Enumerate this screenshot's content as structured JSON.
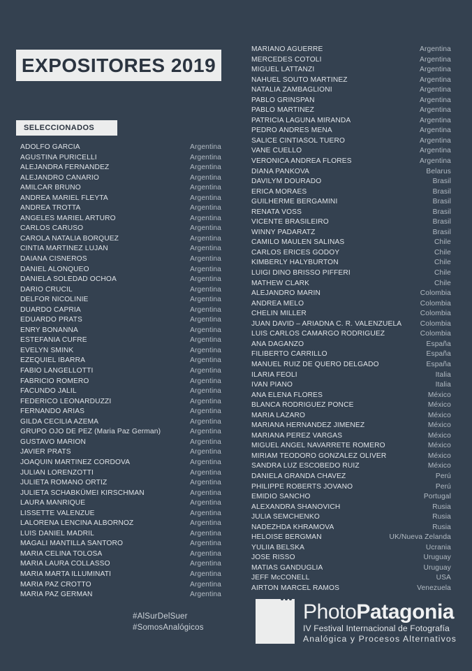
{
  "poster": {
    "background_color": "#344150",
    "panel_color": "#eceded",
    "text_color": "#dfe3e7",
    "country_color": "#b3bcc4"
  },
  "title": "EXPOSITORES 2019",
  "section_label": "SELECCIONADOS",
  "left_column": [
    {
      "name": "ADOLFO GARCIA",
      "country": "Argentina"
    },
    {
      "name": "AGUSTINA PURICELLI",
      "country": "Argentina"
    },
    {
      "name": "ALEJANDRA FERNANDEZ",
      "country": "Argentina"
    },
    {
      "name": "ALEJANDRO CANARIO",
      "country": "Argentina"
    },
    {
      "name": "AMILCAR BRUNO",
      "country": "Argentina"
    },
    {
      "name": "ANDREA MARIEL FLEYTA",
      "country": "Argentina"
    },
    {
      "name": "ANDREA TROTTA",
      "country": "Argentina"
    },
    {
      "name": "ANGELES MARIEL ARTURO",
      "country": "Argentina"
    },
    {
      "name": "CARLOS CARUSO",
      "country": "Argentina"
    },
    {
      "name": "CAROLA NATALIA BORQUEZ",
      "country": "Argentina"
    },
    {
      "name": "CINTIA MARTINEZ LUJAN",
      "country": "Argentina"
    },
    {
      "name": "DAIANA CISNEROS",
      "country": "Argentina"
    },
    {
      "name": "DANIEL ALONQUEO",
      "country": "Argentina"
    },
    {
      "name": "DANIELA SOLEDAD OCHOA",
      "country": "Argentina"
    },
    {
      "name": "DARIO CRUCIL",
      "country": "Argentina"
    },
    {
      "name": "DELFOR NICOLINIE",
      "country": "Argentina"
    },
    {
      "name": "DUARDO CAPRIA",
      "country": "Argentina"
    },
    {
      "name": "EDUARDO PRATS",
      "country": "Argentina"
    },
    {
      "name": "ENRY BONANNA",
      "country": "Argentina"
    },
    {
      "name": "ESTEFANIA CUFRE",
      "country": "Argentina"
    },
    {
      "name": "EVELYN SMINK",
      "country": "Argentina"
    },
    {
      "name": "EZEQUIEL IBARRA",
      "country": "Argentina"
    },
    {
      "name": "FABIO LANGELLOTTI",
      "country": "Argentina"
    },
    {
      "name": "FABRICIO ROMERO",
      "country": "Argentina"
    },
    {
      "name": "FACUNDO JALIL",
      "country": "Argentina"
    },
    {
      "name": "FEDERICO LEONARDUZZI",
      "country": "Argentina"
    },
    {
      "name": "FERNANDO ARIAS",
      "country": "Argentina"
    },
    {
      "name": "GILDA CECILIA AZEMA",
      "country": "Argentina"
    },
    {
      "name": "GRUPO OJO DE PEZ (Maria Paz German)",
      "country": "Argentina"
    },
    {
      "name": "GUSTAVO MARION",
      "country": "Argentina"
    },
    {
      "name": "JAVIER PRATS",
      "country": "Argentina"
    },
    {
      "name": "JOAQUIN MARTINEZ CORDOVA",
      "country": "Argentina"
    },
    {
      "name": "JULIAN LORENZOTTI",
      "country": "Argentina"
    },
    {
      "name": "JULIETA ROMANO ORTIZ",
      "country": "Argentina"
    },
    {
      "name": "JULIETA SCHABKÜMEI KIRSCHMAN",
      "country": "Argentina"
    },
    {
      "name": "LAURA MANRIQUE",
      "country": "Argentina"
    },
    {
      "name": "LISSETTE VALENZUE",
      "country": "Argentina"
    },
    {
      "name": "LALORENA LENCINA ALBORNOZ",
      "country": "Argentina"
    },
    {
      "name": "LUIS DANIEL MADRIL",
      "country": "Argentina"
    },
    {
      "name": "MAGALI MANTILLA SANTORO",
      "country": "Argentina"
    },
    {
      "name": "MARIA CELINA TOLOSA",
      "country": "Argentina"
    },
    {
      "name": "MARIA LAURA COLLASSO",
      "country": "Argentina"
    },
    {
      "name": "MARIA MARTA ILLUMINATI",
      "country": "Argentina"
    },
    {
      "name": "MARIA PAZ CROTTO",
      "country": "Argentina"
    },
    {
      "name": "MARIA PAZ GERMAN",
      "country": "Argentina"
    }
  ],
  "right_column": [
    {
      "name": "MARIANO AGUERRE",
      "country": "Argentina"
    },
    {
      "name": "MERCEDES COTOLI",
      "country": "Argentina"
    },
    {
      "name": "MIGUEL LATTANZI",
      "country": "Argentina"
    },
    {
      "name": "NAHUEL SOUTO MARTINEZ",
      "country": "Argentina"
    },
    {
      "name": "NATALIA ZAMBAGLIONI",
      "country": "Argentina"
    },
    {
      "name": "PABLO GRINSPAN",
      "country": "Argentina"
    },
    {
      "name": "PABLO MARTINEZ",
      "country": "Argentina"
    },
    {
      "name": "PATRICIA LAGUNA MIRANDA",
      "country": "Argentina"
    },
    {
      "name": "PEDRO ANDRES MENA",
      "country": "Argentina"
    },
    {
      "name": "SALICE CINTIASOL TUERO",
      "country": "Argentina"
    },
    {
      "name": "VANE CUELLO",
      "country": "Argentina"
    },
    {
      "name": "VERONICA ANDREA FLORES",
      "country": "Argentina"
    },
    {
      "name": "DIANA PANKOVA",
      "country": "Belarus"
    },
    {
      "name": "DAVILYM DOURADO",
      "country": "Brasil"
    },
    {
      "name": "ERICA MORAES",
      "country": "Brasil"
    },
    {
      "name": "GUILHERME BERGAMINI",
      "country": "Brasil"
    },
    {
      "name": "RENATA VOSS",
      "country": "Brasil"
    },
    {
      "name": "VICENTE BRASILEIRO",
      "country": "Brasil"
    },
    {
      "name": "WINNY PADARATZ",
      "country": "Brasil"
    },
    {
      "name": "CAMILO MAULEN SALINAS",
      "country": "Chile"
    },
    {
      "name": "CARLOS ERICES GODOY",
      "country": "Chile"
    },
    {
      "name": "KIMBERLY HALYBURTON",
      "country": "Chile"
    },
    {
      "name": "LUIGI DINO BRISSO PIFFERI",
      "country": "Chile"
    },
    {
      "name": "MATHEW CLARK",
      "country": "Chile"
    },
    {
      "name": "ALEJANDRO MARIN",
      "country": "Colombia"
    },
    {
      "name": "ANDREA MELO",
      "country": "Colombia"
    },
    {
      "name": "CHELIN MILLER",
      "country": "Colombia"
    },
    {
      "name": "JUAN DAVID – ARIADNA C. R. VALENZUELA",
      "country": "Colombia"
    },
    {
      "name": "LUIS CARLOS CAMARGO RODRIGUEZ",
      "country": "Colombia"
    },
    {
      "name": "ANA DAGANZO",
      "country": "España"
    },
    {
      "name": "FILIBERTO CARRILLO",
      "country": "España"
    },
    {
      "name": "MANUEL RUIZ DE QUERO DELGADO",
      "country": "España"
    },
    {
      "name": "ILARIA FEOLI",
      "country": "Italia"
    },
    {
      "name": "IVAN PIANO",
      "country": "Italia"
    },
    {
      "name": "ANA ELENA FLORES",
      "country": "México"
    },
    {
      "name": "BLANCA RODRIGUEZ PONCE",
      "country": "México"
    },
    {
      "name": "MARIA LAZARO",
      "country": "México"
    },
    {
      "name": "MARIANA HERNANDEZ JIMENEZ",
      "country": "México"
    },
    {
      "name": "MARIANA PEREZ VARGAS",
      "country": "México"
    },
    {
      "name": "MIGUEL ANGEL NAVARRETE ROMERO",
      "country": "México"
    },
    {
      "name": "MIRIAM TEODORO GONZALEZ OLIVER",
      "country": "México"
    },
    {
      "name": "SANDRA LUZ ESCOBEDO RUIZ",
      "country": "México"
    },
    {
      "name": "DANIELA GRANDA CHAVEZ",
      "country": "Perú"
    },
    {
      "name": "PHILIPPE ROBERTS JOVANO",
      "country": "Perú"
    },
    {
      "name": "EMIDIO SANCHO",
      "country": "Portugal"
    },
    {
      "name": "ALEXANDRA SHANOVICH",
      "country": "Rusia"
    },
    {
      "name": "JULIA SEMCHENKO",
      "country": "Rusia"
    },
    {
      "name": "NADEZHDA KHRAMOVA",
      "country": "Rusia"
    },
    {
      "name": "HELOISE BERGMAN",
      "country": "UK/Nueva Zelanda"
    },
    {
      "name": "YULIIA BELSKA",
      "country": "Ucrania"
    },
    {
      "name": "JOSE RISSO",
      "country": "Uruguay"
    },
    {
      "name": "MATIAS GANDUGLIA",
      "country": "Uruguay"
    },
    {
      "name": "JEFF McCONELL",
      "country": "USA"
    },
    {
      "name": "AIRTON MARCEL RAMOS",
      "country": "Venezuela"
    }
  ],
  "footer": {
    "hashtags": [
      "#AlSurDelSuer",
      "#SomosAnalógicos"
    ],
    "logo": {
      "brand_light": "Photo",
      "brand_bold": "Patagonia",
      "subtitle_line1": "IV Festival Internacional de Fotografía",
      "subtitle_line2": "Analógica  y  Procesos  Alternativos"
    }
  }
}
